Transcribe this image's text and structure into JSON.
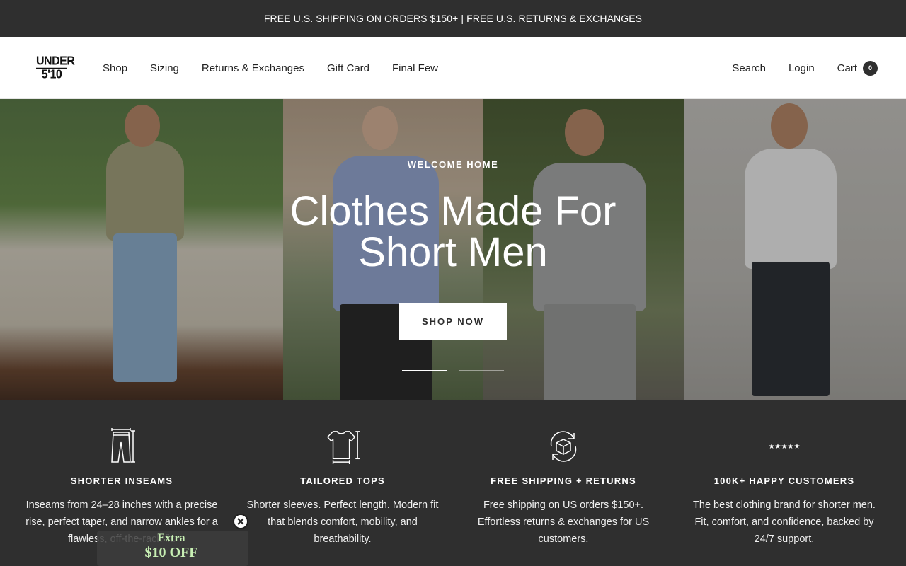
{
  "announcement": "FREE U.S. SHIPPING ON ORDERS $150+ | FREE U.S. RETURNS & EXCHANGES",
  "logo": {
    "line1": "UNDER",
    "line2": "5'10"
  },
  "nav": {
    "items": [
      "Shop",
      "Sizing",
      "Returns & Exchanges",
      "Gift Card",
      "Final Few"
    ]
  },
  "header_right": {
    "search": "Search",
    "login": "Login",
    "cart": "Cart",
    "cart_count": "0"
  },
  "hero": {
    "eyebrow": "WELCOME HOME",
    "title": "Clothes Made For Short Men",
    "button": "SHOP NOW",
    "slides_total": 2,
    "active_slide": 1
  },
  "features": [
    {
      "icon": "pants-measure-icon",
      "title": "SHORTER INSEAMS",
      "desc": "Inseams from 24–28 inches with a precise rise, perfect taper, and narrow ankles for a flawless, off-the-rack fit."
    },
    {
      "icon": "shirt-measure-icon",
      "title": "TAILORED TOPS",
      "desc": "Shorter sleeves. Perfect length. Modern fit that blends comfort, mobility, and breathability."
    },
    {
      "icon": "box-return-icon",
      "title": "FREE SHIPPING + RETURNS",
      "desc": "Free shipping on US orders $150+. Effortless returns & exchanges for US customers."
    },
    {
      "icon": "five-stars-icon",
      "title": "100K+ HAPPY CUSTOMERS",
      "desc": "The best clothing brand for shorter men. Fit, comfort, and confidence, backed by 24/7 support."
    }
  ],
  "popup": {
    "line1": "Extra",
    "line2": "$10 OFF"
  },
  "colors": {
    "dark": "#2f2f2f",
    "popup_text": "#c8f0b4"
  }
}
